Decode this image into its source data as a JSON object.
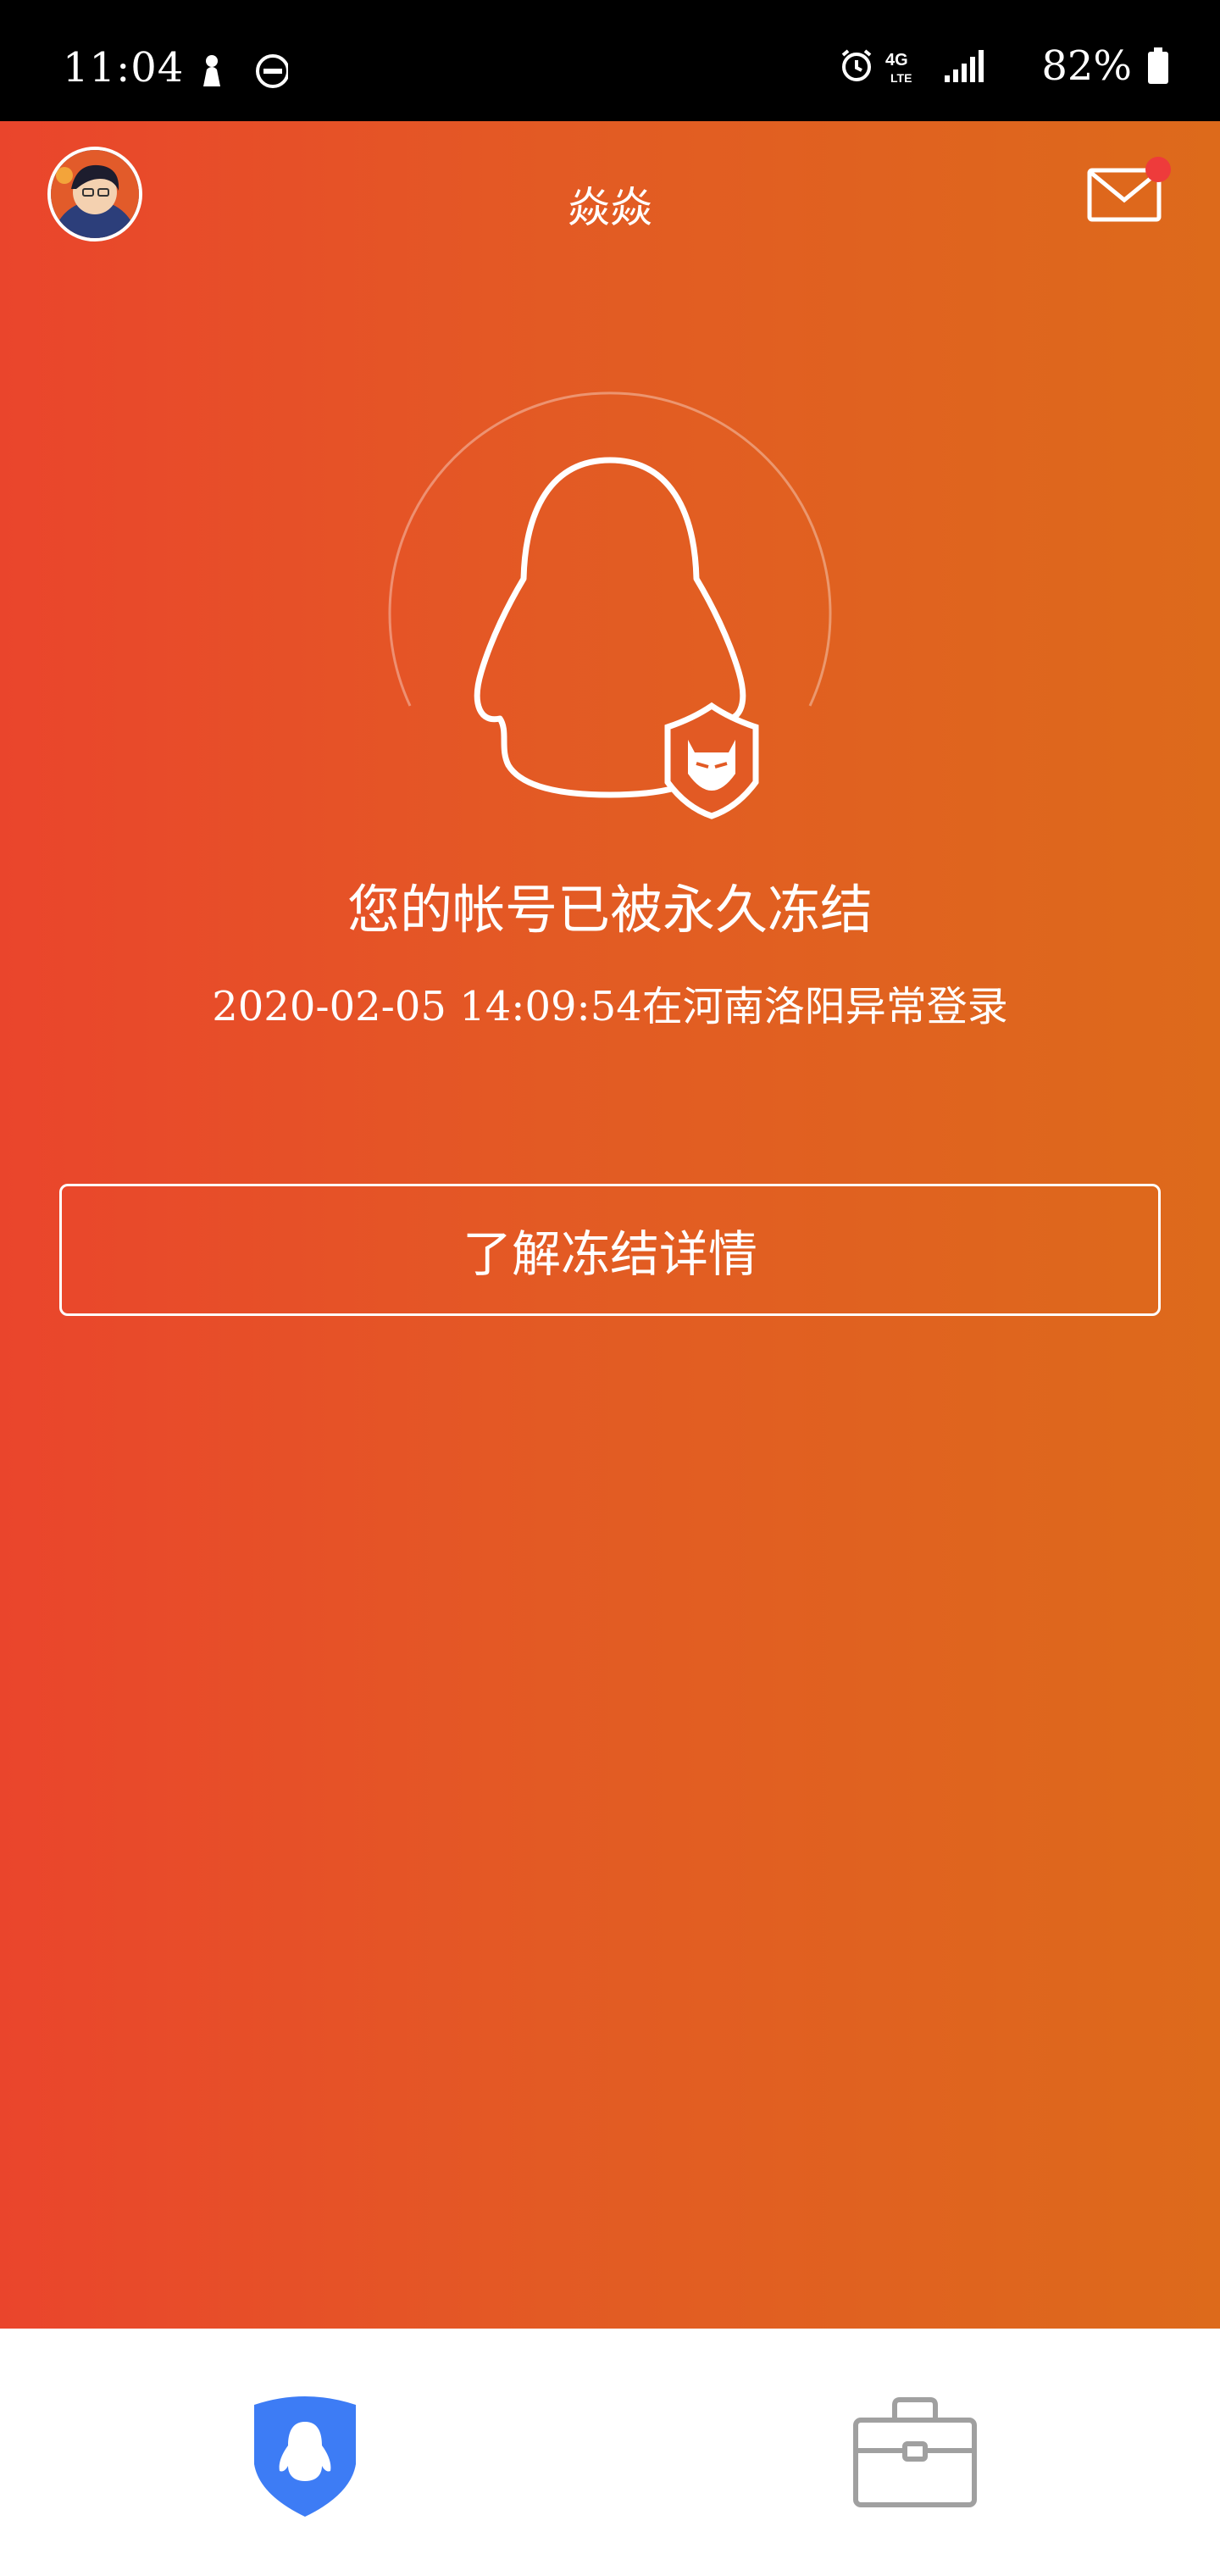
{
  "status_bar": {
    "time": "11:04",
    "network": "4G LTE",
    "battery": "82%"
  },
  "header": {
    "title": "焱焱"
  },
  "freeze_notice": {
    "title": "您的帐号已被永久冻结",
    "detail": "2020-02-05 14:09:54在河南洛阳异常登录"
  },
  "actions": {
    "learn_more_label": "了解冻结详情"
  },
  "colors": {
    "gradient_start": "#ea452c",
    "gradient_end": "#dd6a1b",
    "notification_dot": "#ee3b3b",
    "tab_active": "#3d7cf5",
    "tab_inactive": "#a0a0a0"
  },
  "tabs": [
    {
      "icon": "qq-shield-icon",
      "active": true
    },
    {
      "icon": "briefcase-icon",
      "active": false
    }
  ]
}
